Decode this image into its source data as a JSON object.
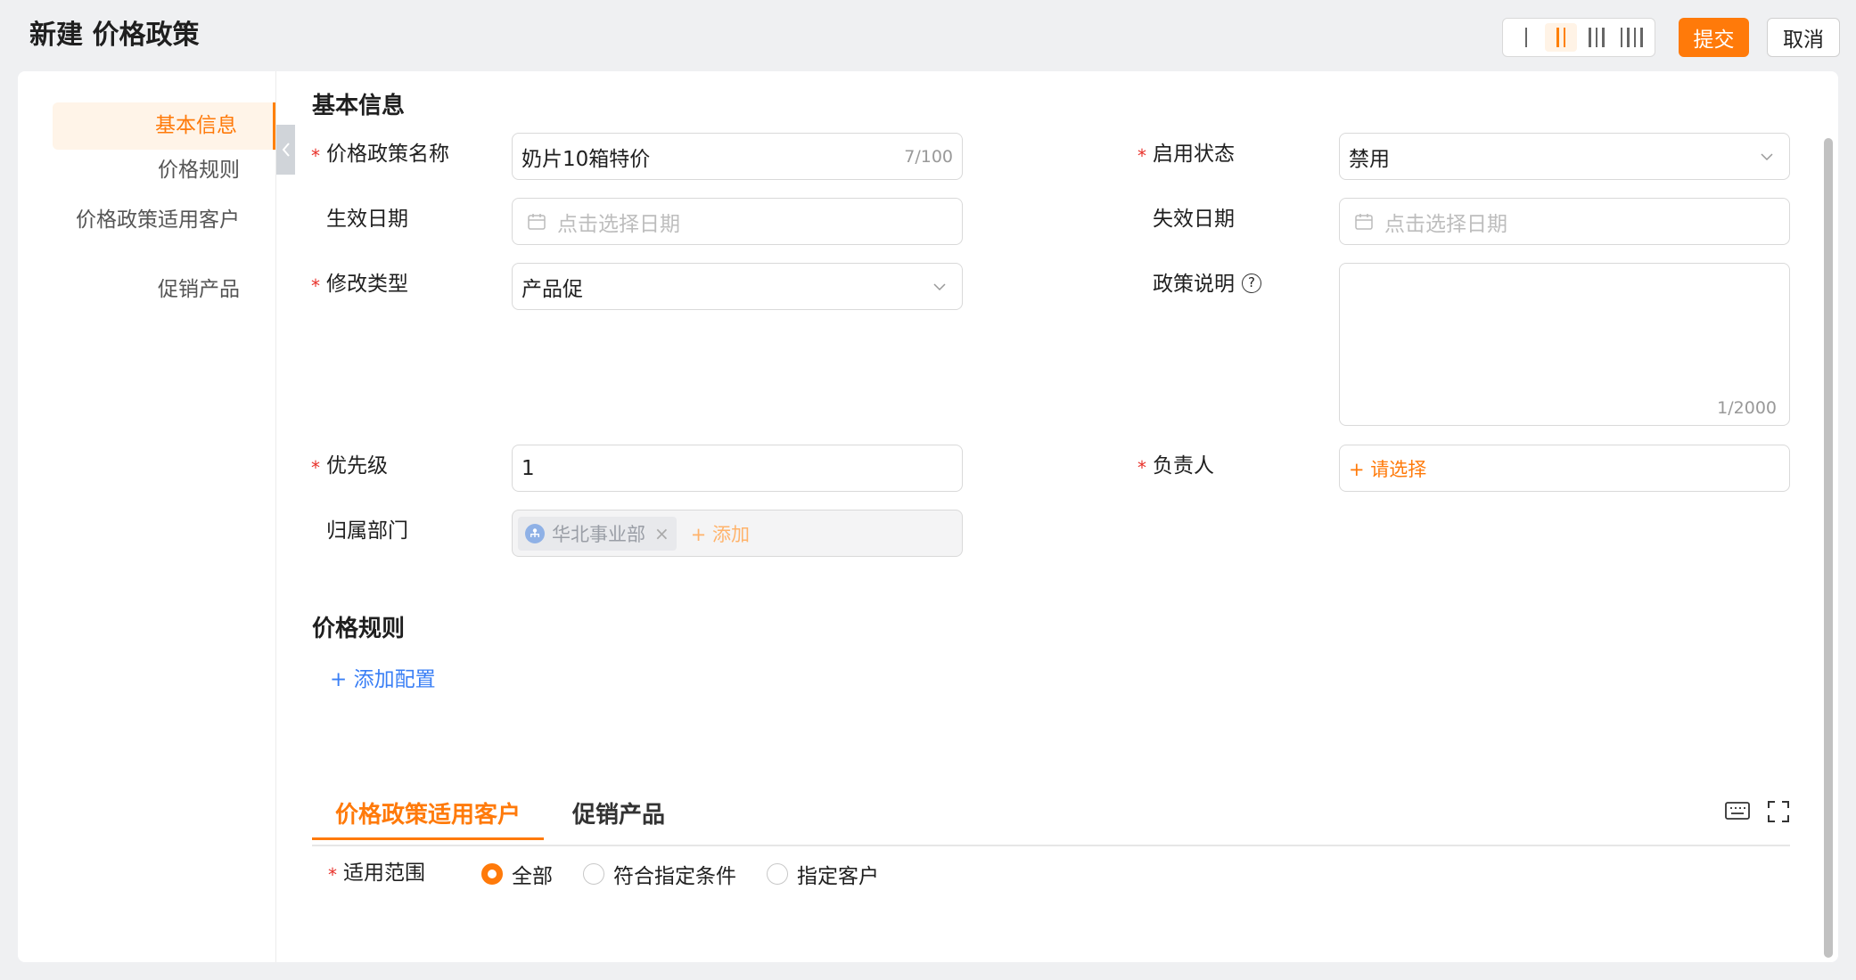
{
  "header": {
    "title": "新建 价格政策",
    "submit_label": "提交",
    "cancel_label": "取消"
  },
  "layout_switch": {
    "options": [
      "1-column-icon",
      "2-column-icon",
      "3-column-icon",
      "4-column-icon"
    ],
    "active": "2-column-icon"
  },
  "sidebar": {
    "items": [
      {
        "label": "基本信息",
        "active": true
      },
      {
        "label": "价格规则"
      },
      {
        "label": "价格政策适用客户"
      },
      {
        "label": "促销产品"
      }
    ]
  },
  "basic_info": {
    "title": "基本信息",
    "policy_name": {
      "label": "价格政策名称",
      "value": "奶片10箱特价",
      "count": "7/100",
      "required": true
    },
    "status": {
      "label": "启用状态",
      "value": "禁用",
      "required": true
    },
    "effective_date": {
      "label": "生效日期",
      "placeholder": "点击选择日期"
    },
    "expiry_date": {
      "label": "失效日期",
      "placeholder": "点击选择日期"
    },
    "modify_type": {
      "label": "修改类型",
      "value": "产品促",
      "required": true
    },
    "description": {
      "label": "政策说明",
      "help": "?",
      "count": "1/2000"
    },
    "priority": {
      "label": "优先级",
      "value": "1",
      "required": true
    },
    "owner": {
      "label": "负责人",
      "pick": "+ 请选择",
      "required": true
    },
    "department": {
      "label": "归属部门",
      "tag": "华北事业部",
      "tag_remove": "×",
      "add": "+ 添加"
    }
  },
  "price_rules": {
    "title": "价格规则",
    "add_label": "+ 添加配置"
  },
  "tabs": [
    {
      "label": "价格政策适用客户",
      "active": true
    },
    {
      "label": "促销产品"
    }
  ],
  "scope": {
    "label": "适用范围",
    "required": true,
    "options": [
      {
        "label": "全部",
        "selected": true
      },
      {
        "label": "符合指定条件"
      },
      {
        "label": "指定客户"
      }
    ]
  },
  "colors": {
    "accent": "#ff7a0a",
    "link": "#3a7ff5",
    "required": "#e8312a"
  }
}
